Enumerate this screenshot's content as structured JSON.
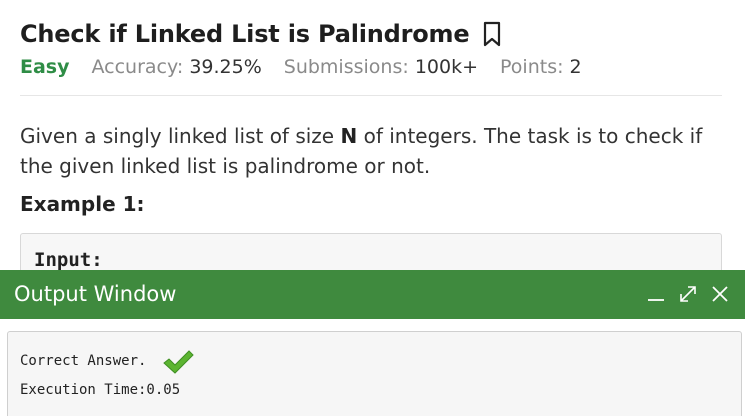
{
  "problem": {
    "title": "Check if Linked List is Palindrome",
    "difficulty": "Easy",
    "accuracy_label": "Accuracy:",
    "accuracy_value": "39.25%",
    "submissions_label": "Submissions:",
    "submissions_value": "100k+",
    "points_label": "Points:",
    "points_value": "2",
    "description_part1": "Given a singly linked list of size ",
    "description_bold": "N",
    "description_part2": " of integers. The task is to check if the given linked list is palindrome or not.",
    "example_title": "Example 1:",
    "example_input_label": "Input:"
  },
  "output_window": {
    "title": "Output Window",
    "result_text": "Correct Answer.",
    "execution_time": "Execution Time:0.05"
  },
  "colors": {
    "accent_green": "#2f8d46",
    "output_header": "#3f8a3e",
    "check_green": "#5cb431"
  },
  "icons": {
    "bookmark": "bookmark-icon",
    "minimize": "minimize-icon",
    "expand": "expand-icon",
    "close": "close-icon",
    "check": "checkmark-icon"
  }
}
